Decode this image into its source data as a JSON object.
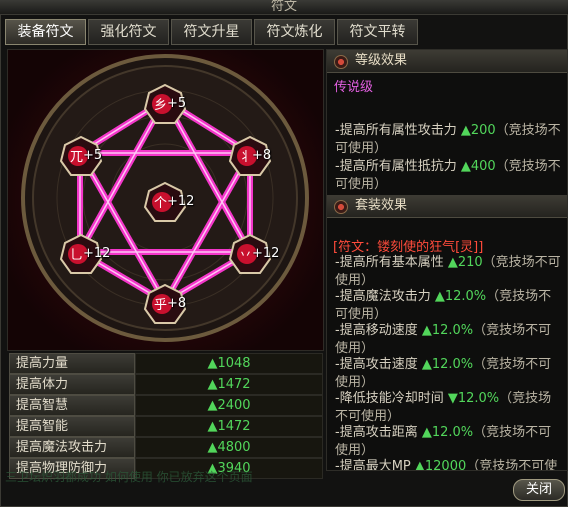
{
  "window": {
    "title": "符文"
  },
  "tabs": [
    {
      "label": "装备符文",
      "active": true
    },
    {
      "label": "强化符文"
    },
    {
      "label": "符文升星"
    },
    {
      "label": "符文炼化"
    },
    {
      "label": "符文平转"
    }
  ],
  "runes": [
    {
      "glyph": "乡",
      "level": "+5"
    },
    {
      "glyph": "兀",
      "level": "+5"
    },
    {
      "glyph": "丬",
      "level": "+8"
    },
    {
      "glyph": "个",
      "level": "+12"
    },
    {
      "glyph": "乚",
      "level": "+12"
    },
    {
      "glyph": "丷",
      "level": "+12"
    },
    {
      "glyph": "乎",
      "level": "+8"
    }
  ],
  "stats": [
    {
      "label": "提高力量",
      "value": "▲1048"
    },
    {
      "label": "提高体力",
      "value": "▲1472"
    },
    {
      "label": "提高智慧",
      "value": "▲2400"
    },
    {
      "label": "提高智能",
      "value": "▲1472"
    },
    {
      "label": "提高魔法攻击力",
      "value": "▲4800"
    },
    {
      "label": "提高物理防御力",
      "value": "▲3940"
    }
  ],
  "level_effect": {
    "title": "等级效果",
    "grade": "传说级",
    "lines": [
      {
        "prefix": "-提高所有属性攻击力 ",
        "value": "▲200",
        "note": "（竞技场不可使用）"
      },
      {
        "prefix": "-提高所有属性抵抗力 ",
        "value": "▲400",
        "note": "（竞技场不可使用）"
      }
    ]
  },
  "set_effect": {
    "title": "套装效果",
    "set_name": "[符文：镂刻使的狂气[灵]]",
    "lines": [
      {
        "prefix": "-提高所有基本属性 ",
        "value": "▲210",
        "note": "（竞技场不可使用）"
      },
      {
        "prefix": "-提高魔法攻击力 ",
        "value": "▲12.0%",
        "note": "（竞技场不可使用）"
      },
      {
        "prefix": "-提高移动速度 ",
        "value": "▲12.0%",
        "note": "（竞技场不可使用）"
      },
      {
        "prefix": "-提高攻击速度 ",
        "value": "▲12.0%",
        "note": "（竞技场不可使用）"
      },
      {
        "prefix": "-降低技能冷却时间 ",
        "value": "▼12.0%",
        "note": "（竞技场不可使用）"
      },
      {
        "prefix": "-提高攻击距离 ",
        "value": "▲12.0%",
        "note": "（竞技场不可使用）"
      },
      {
        "prefix": "-提高最大MP ",
        "value": "▲12000",
        "note": "（竞技场不可使用）"
      }
    ]
  },
  "footer": {
    "text": "三卫坛炽羽都成功 如何使用 你已放弃这个页面",
    "close_label": "关闭"
  },
  "colors": {
    "accent": "#ff3dd6",
    "value_green": "#52d65b",
    "legend": "#e25fe0",
    "set_name": "#ff4b3b"
  }
}
